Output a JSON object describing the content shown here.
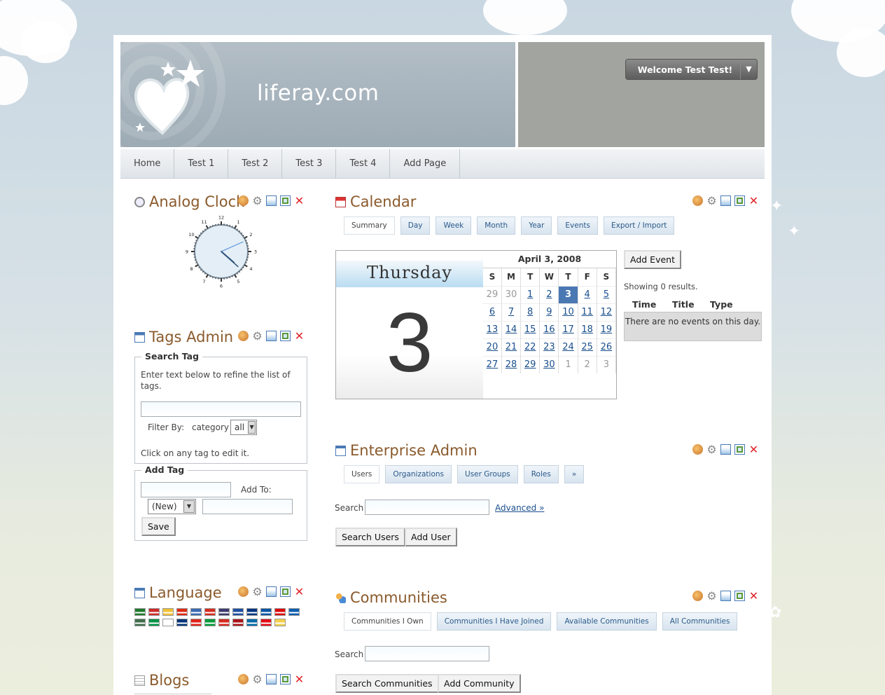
{
  "header": {
    "logo_text": "liferay.com",
    "welcome_label": "Welcome Test Test!",
    "welcome_arrow": "▼"
  },
  "nav": {
    "tabs": [
      {
        "label": "Home"
      },
      {
        "label": "Test 1"
      },
      {
        "label": "Test 2"
      },
      {
        "label": "Test 3"
      },
      {
        "label": "Test 4"
      },
      {
        "label": "Add Page"
      }
    ]
  },
  "analog_clock": {
    "title": "Analog Clock",
    "numbers": [
      "12",
      "1",
      "2",
      "3",
      "4",
      "5",
      "6",
      "7",
      "8",
      "9",
      "10",
      "11"
    ],
    "time": {
      "hour": 4,
      "minute": 22,
      "second": 11
    }
  },
  "tags_admin": {
    "title": "Tags Admin",
    "search_legend": "Search Tag",
    "search_hint": "Enter text below to refine the list of tags.",
    "filter_label": "Filter By:",
    "filter_category": "category",
    "filter_value": "all",
    "click_hint": "Click on any tag to edit it.",
    "add_legend": "Add Tag",
    "add_to_label": "Add To:",
    "add_to_value": "(New)",
    "save_label": "Save"
  },
  "language": {
    "title": "Language",
    "row1": [
      "#1f7a2e",
      "#cc2a2a",
      "#f1c232",
      "#de2910",
      "#3a6ab4",
      "#d52b1e",
      "#3c3b6e",
      "#1f4fa1",
      "#003580",
      "#0055a4",
      "#dd0000",
      "#0d5eaf"
    ],
    "row2": [
      "#436f4d",
      "#009246",
      "#ffffff",
      "#003478",
      "#e2231a",
      "#009b3a",
      "#d52b1e",
      "#aa151b",
      "#006aa7",
      "#e30a17",
      "#f2d14c"
    ]
  },
  "blogs": {
    "title": "Blogs"
  },
  "calendar": {
    "title": "Calendar",
    "tabs": [
      "Summary",
      "Day",
      "Week",
      "Month",
      "Year",
      "Events",
      "Export / Import"
    ],
    "day_name": "Thursday",
    "day_number": "3",
    "month_title": "April 3, 2008",
    "weekdays": [
      "S",
      "M",
      "T",
      "W",
      "T",
      "F",
      "S"
    ],
    "weeks": [
      [
        "29",
        "30",
        "1",
        "2",
        "3",
        "4",
        "5"
      ],
      [
        "6",
        "7",
        "8",
        "9",
        "10",
        "11",
        "12"
      ],
      [
        "13",
        "14",
        "15",
        "16",
        "17",
        "18",
        "19"
      ],
      [
        "20",
        "21",
        "22",
        "23",
        "24",
        "25",
        "26"
      ],
      [
        "27",
        "28",
        "29",
        "30",
        "1",
        "2",
        "3"
      ]
    ],
    "add_event_label": "Add Event",
    "results_text": "Showing 0 results.",
    "columns": [
      "Time",
      "Title",
      "Type"
    ],
    "empty_text": "There are no events on this day."
  },
  "enterprise_admin": {
    "title": "Enterprise Admin",
    "tabs": [
      "Users",
      "Organizations",
      "User Groups",
      "Roles",
      "»"
    ],
    "search_label": "Search",
    "advanced_link": "Advanced »",
    "search_button": "Search Users",
    "add_button": "Add User"
  },
  "communities": {
    "title": "Communities",
    "tabs": [
      "Communities I Own",
      "Communities I Have Joined",
      "Available Communities",
      "All Communities"
    ],
    "search_label": "Search",
    "search_button": "Search Communities",
    "add_button": "Add Community"
  }
}
